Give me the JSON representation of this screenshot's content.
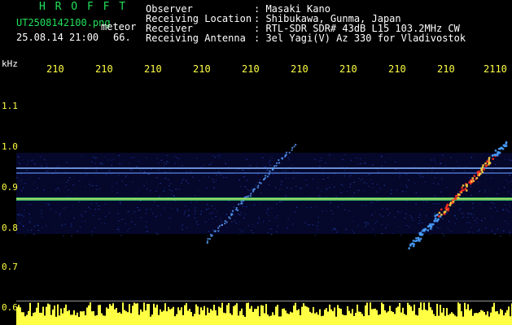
{
  "header": {
    "app_title": "H R O F F T",
    "file_name": "UT2508142100.png",
    "detection_label": "meteor",
    "timestamp": "25.08.14 21:00",
    "count": "66."
  },
  "info": {
    "labels": [
      "Observer",
      "Receiving Location",
      "Receiver",
      "Receiving Antenna"
    ],
    "values": [
      ": Masaki Kano",
      ": Shibukawa, Gunma, Japan",
      ": RTL-SDR SDR# 43dB L15 103.2MHz CW",
      ": 3el Yagi(V) Az 330 for Vladivostok"
    ]
  },
  "axes": {
    "y_unit": "kHz",
    "y_ticks": [
      "1.1",
      "1.0",
      "0.9",
      "0.8",
      "0.7",
      "0.6"
    ],
    "x_ticks": [
      "210",
      "210",
      "210",
      "210",
      "210",
      "210",
      "210",
      "210",
      "210",
      "2110"
    ]
  },
  "colors": {
    "background": "#000000",
    "noise": "#0a1060",
    "signal": "#4a90ff",
    "strong": "#ff3020",
    "header_green": "#22e05a",
    "power_yellow": "#ffff44"
  }
}
